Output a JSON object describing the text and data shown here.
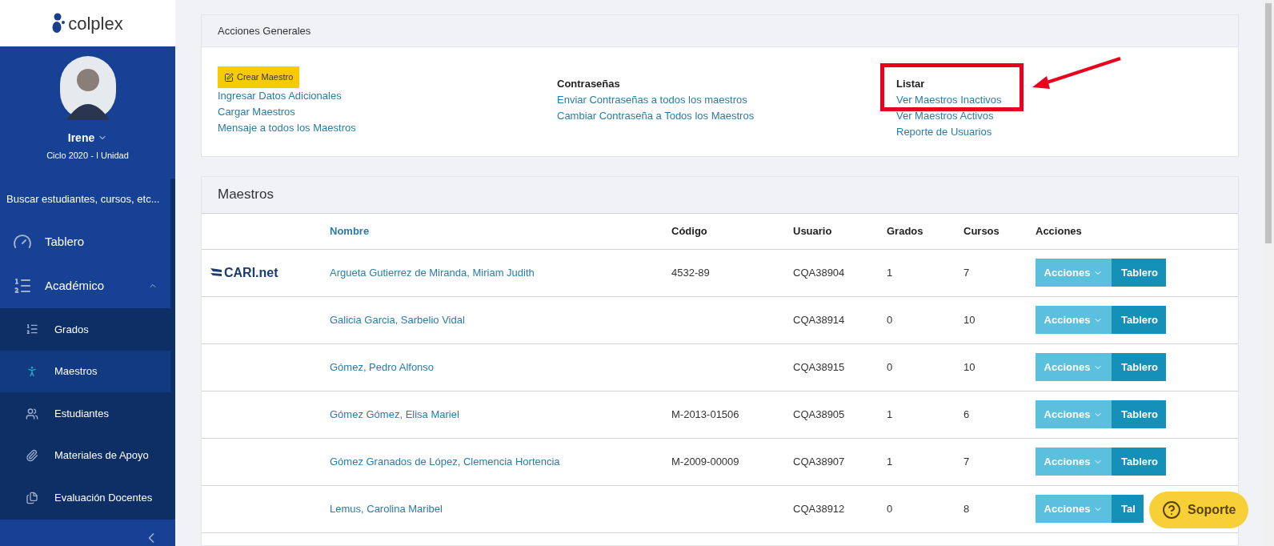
{
  "brand": {
    "name": "colplex"
  },
  "user": {
    "name": "Irene",
    "cycle": "Ciclo 2020 - I Unidad"
  },
  "search": {
    "placeholder": "Buscar estudiantes, cursos, etc..."
  },
  "nav": [
    {
      "kind": "item",
      "label": "Tablero",
      "selected": false
    },
    {
      "kind": "group",
      "label": "Académico",
      "expanded": true,
      "children": [
        {
          "label": "Grados",
          "selected": false
        },
        {
          "label": "Maestros",
          "selected": true
        },
        {
          "label": "Estudiantes",
          "selected": false
        },
        {
          "label": "Materiales de Apoyo",
          "selected": false
        },
        {
          "label": "Evaluación Docentes",
          "selected": false
        }
      ]
    }
  ],
  "actions_panel": {
    "title": "Acciones Generales",
    "create_button": "Crear Maestro",
    "columns": [
      {
        "links": [
          "Ingresar Datos Adicionales",
          "Cargar Maestros",
          "Mensaje a todos los Maestros"
        ]
      },
      {
        "heading": "Contraseñas",
        "links": [
          "Enviar Contraseñas a todos los maestros",
          "Cambiar Contraseña a Todos los Maestros"
        ]
      },
      {
        "heading": "Listar",
        "links": [
          "Ver Maestros Inactivos",
          "Ver Maestros Activos",
          "Reporte de Usuarios"
        ]
      }
    ]
  },
  "table": {
    "title": "Maestros",
    "columns": [
      "Nombre",
      "Código",
      "Usuario",
      "Grados",
      "Cursos",
      "Acciones"
    ],
    "rows": [
      {
        "logo": "CARI.net",
        "name": "Argueta Gutierrez de Miranda, Miriam Judith",
        "code": "4532-89",
        "user": "CQA38904",
        "grades": "1",
        "courses": "7",
        "actions": "Acciones",
        "board": "Tablero"
      },
      {
        "name": "Galicia Garcia, Sarbelio Vidal",
        "code": "",
        "user": "CQA38914",
        "grades": "0",
        "courses": "10",
        "actions": "Acciones",
        "board": "Tablero"
      },
      {
        "name": "Gómez, Pedro Alfonso",
        "code": "",
        "user": "CQA38915",
        "grades": "0",
        "courses": "10",
        "actions": "Acciones",
        "board": "Tablero"
      },
      {
        "name": "Gómez Gómez, Elisa Mariel",
        "code": "M-2013-01506",
        "user": "CQA38905",
        "grades": "1",
        "courses": "6",
        "actions": "Acciones",
        "board": "Tablero"
      },
      {
        "name": "Gómez Granados de López, Clemencia Hortencia",
        "code": "M-2009-00009",
        "user": "CQA38907",
        "grades": "1",
        "courses": "7",
        "actions": "Acciones",
        "board": "Tablero"
      },
      {
        "name": "Lemus, Carolina Maribel",
        "code": "",
        "user": "CQA38912",
        "grades": "0",
        "courses": "8",
        "actions": "Acciones",
        "board": "Tal"
      }
    ]
  },
  "support_button": {
    "label": "Soporte"
  }
}
